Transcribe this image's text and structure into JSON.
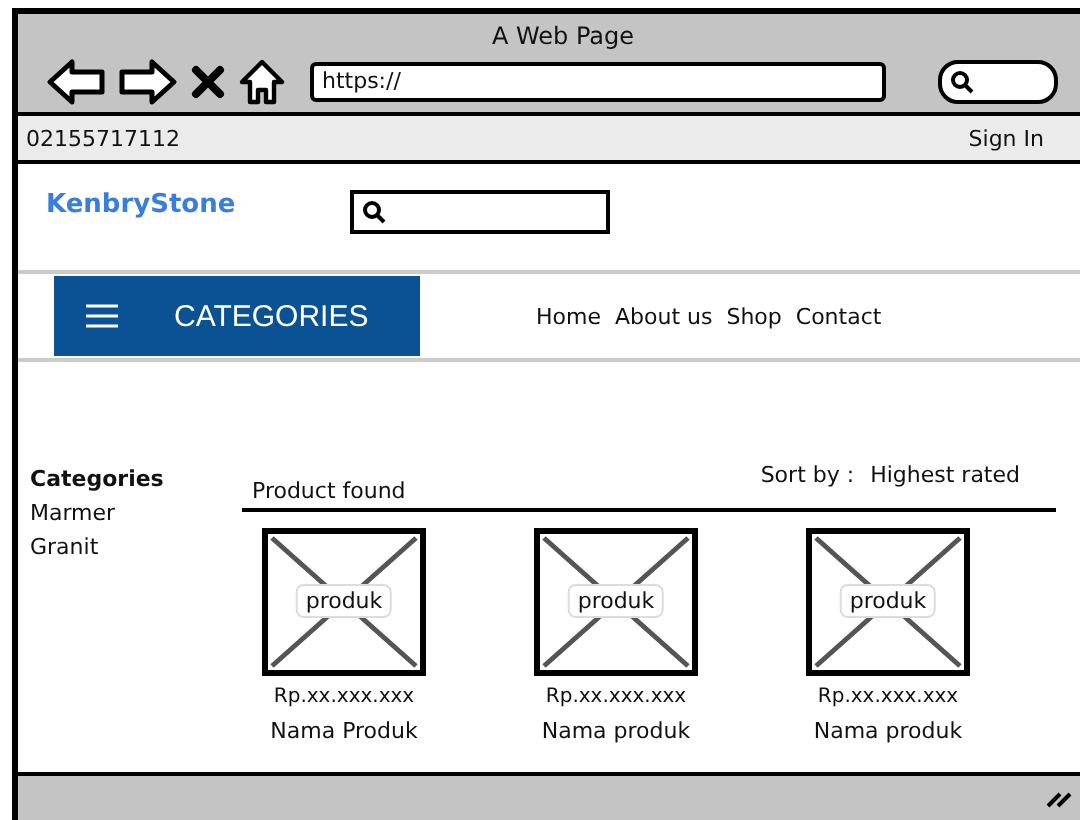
{
  "window": {
    "title": "A Web Page",
    "address": "https://"
  },
  "top_bar": {
    "phone": "02155717112",
    "sign_in": "Sign In"
  },
  "header": {
    "logo": "KenbryStone"
  },
  "nav": {
    "categories_button": "CATEGORIES",
    "links": [
      "Home",
      "About us",
      "Shop",
      "Contact"
    ]
  },
  "sidebar": {
    "title": "Categories",
    "items": [
      "Marmer",
      "Granit"
    ]
  },
  "results": {
    "label": "Product found",
    "sort_label": "Sort by :",
    "sort_value": "Highest rated"
  },
  "products": [
    {
      "image_label": "produk",
      "price": "Rp.xx.xxx.xxx",
      "name": "Nama Produk"
    },
    {
      "image_label": "produk",
      "price": "Rp.xx.xxx.xxx",
      "name": "Nama produk"
    },
    {
      "image_label": "produk",
      "price": "Rp.xx.xxx.xxx",
      "name": "Nama produk"
    }
  ]
}
